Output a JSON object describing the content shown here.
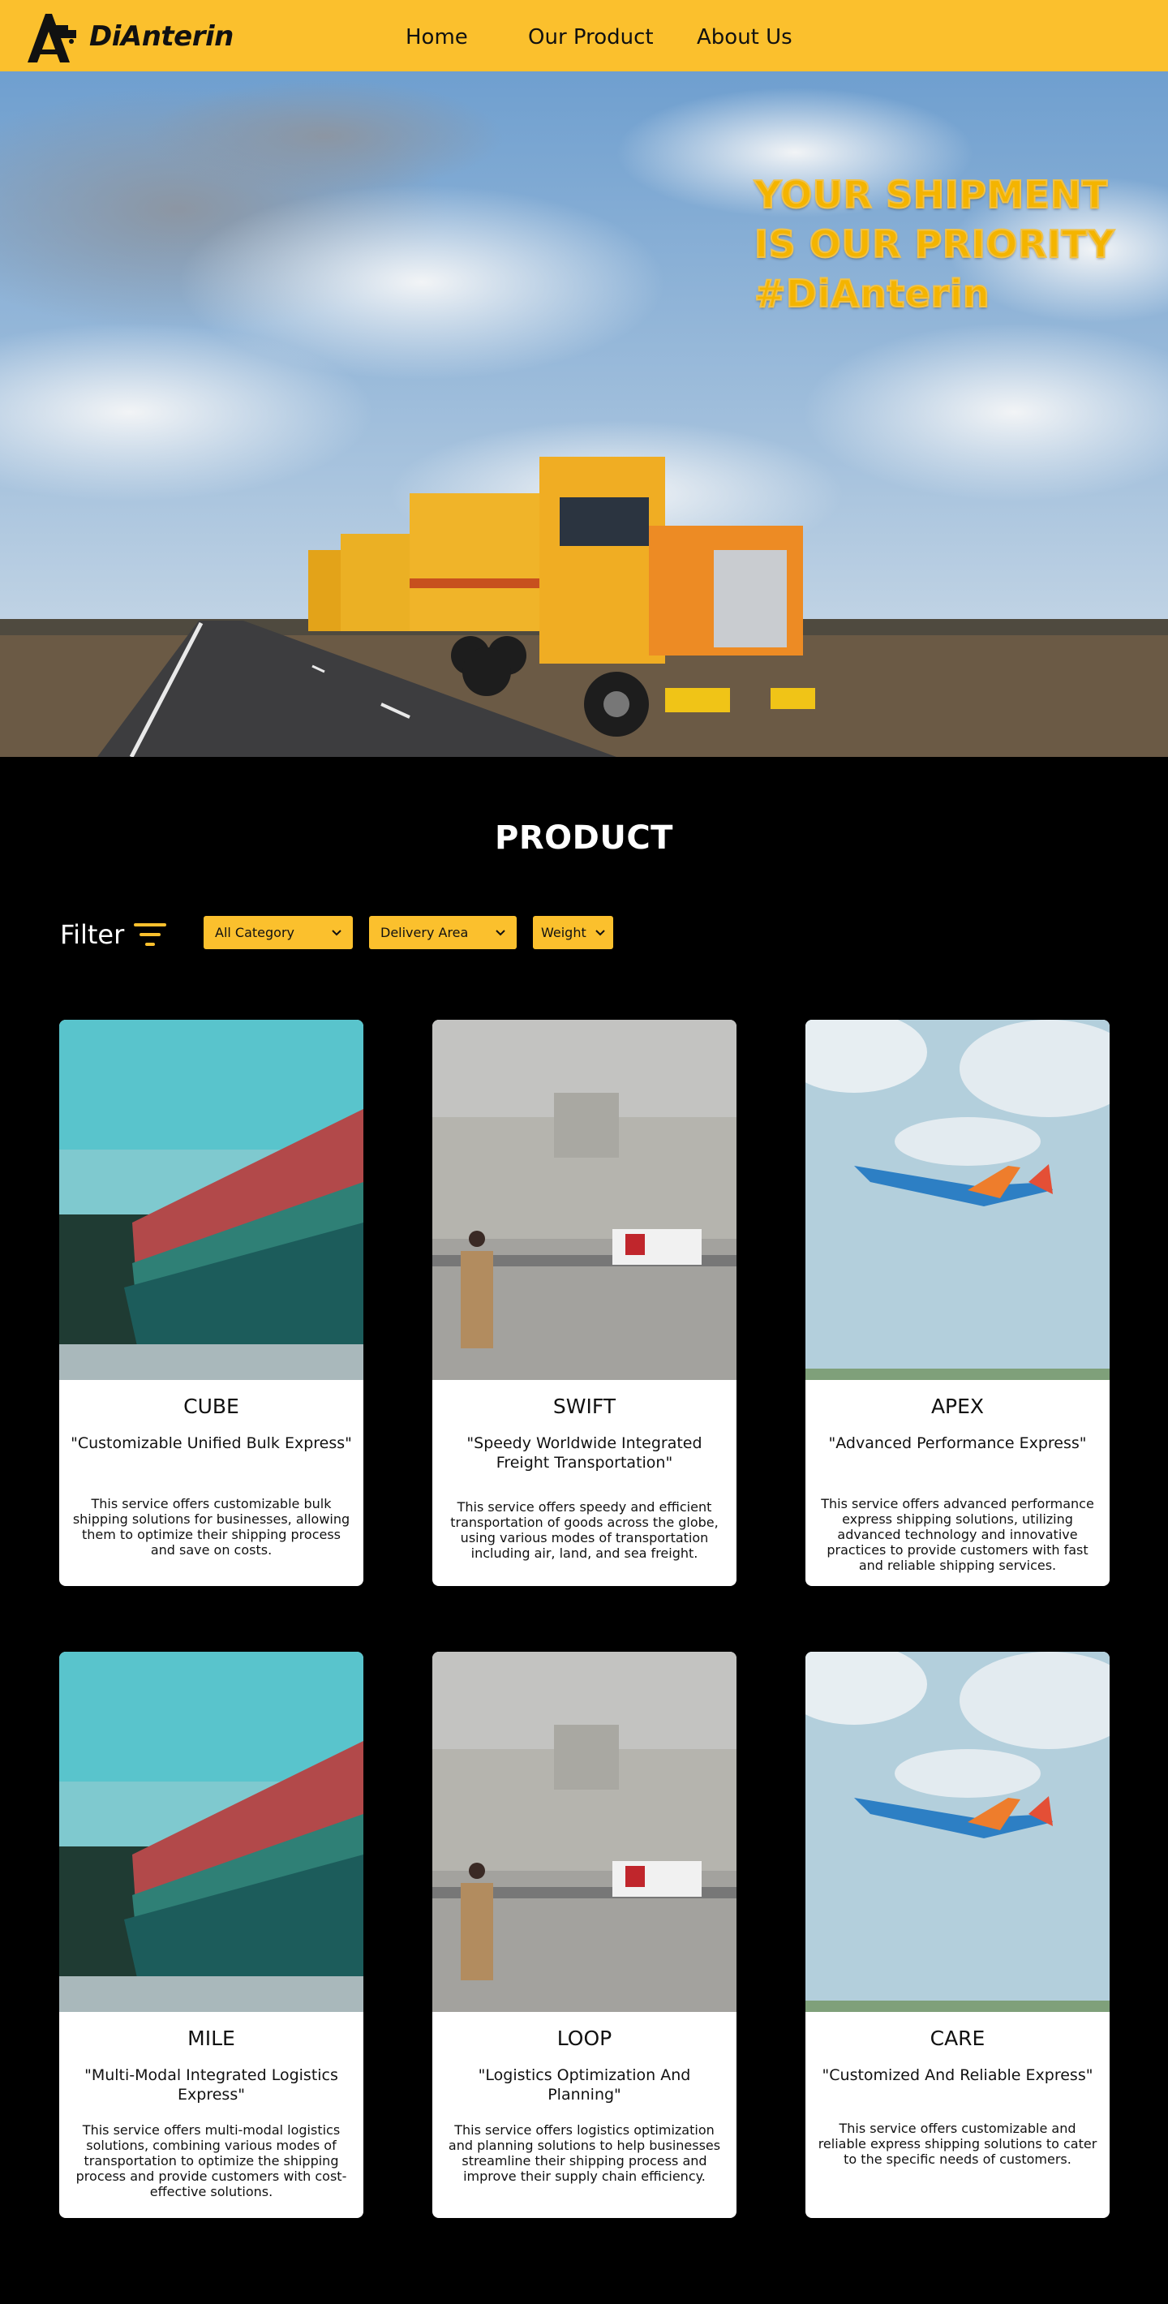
{
  "brand": {
    "name": "DiAnterin"
  },
  "nav": {
    "home": "Home",
    "product": "Our Product",
    "about": "About Us"
  },
  "hero": {
    "line1": "YOUR SHIPMENT",
    "line2": "IS OUR PRIORITY",
    "line3": "#DiAnterin"
  },
  "section": {
    "title": "PRODUCT"
  },
  "filter": {
    "label": "Filter",
    "category": "All Category",
    "area": "Delivery Area",
    "weight": "Weight"
  },
  "cards": [
    {
      "name": "CUBE",
      "subtitle": "\"Customizable Unified Bulk Express\"",
      "description": "This service offers customizable bulk shipping solutions for businesses, allowing them to optimize their shipping process and save on costs.",
      "image": "container-ship"
    },
    {
      "name": "SWIFT",
      "subtitle": "\"Speedy Worldwide Integrated Freight Transportation\"",
      "description": "This service offers speedy and efficient transportation of goods across the globe, using various modes of transportation including air, land, and sea freight.",
      "image": "courier-van"
    },
    {
      "name": "APEX",
      "subtitle": "\"Advanced Performance Express\"",
      "description": "This service offers advanced performance express shipping solutions, utilizing advanced technology and innovative practices to provide customers with fast and reliable shipping services.",
      "image": "airplane"
    },
    {
      "name": "MILE",
      "subtitle": "\"Multi-Modal Integrated Logistics Express\"",
      "description": "This service offers multi-modal logistics solutions, combining various modes of transportation to optimize the shipping process and provide customers with cost-effective solutions.",
      "image": "container-ship"
    },
    {
      "name": "LOOP",
      "subtitle": "\"Logistics Optimization And Planning\"",
      "description": "This service offers logistics optimization and planning solutions to help businesses streamline their shipping process and improve their supply chain efficiency.",
      "image": "courier-van"
    },
    {
      "name": "CARE",
      "subtitle": "\"Customized And Reliable Express\"",
      "description": "This service offers customizable and reliable express shipping solutions to cater to the specific needs of customers.",
      "image": "airplane"
    }
  ],
  "colors": {
    "accent": "#fbc02d",
    "background": "#000000",
    "card": "#ffffff"
  }
}
